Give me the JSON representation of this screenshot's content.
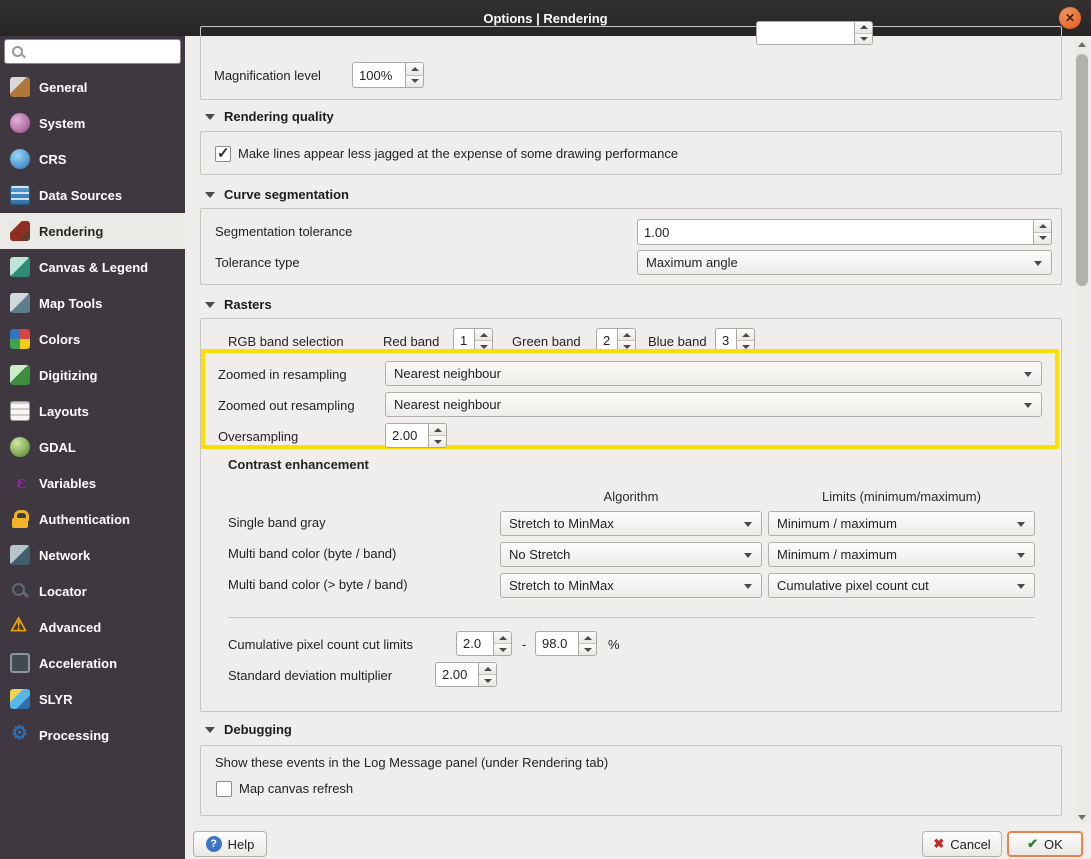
{
  "window": {
    "title": "Options | Rendering"
  },
  "sidebar": {
    "search": {
      "value": "",
      "placeholder": ""
    },
    "items": [
      {
        "label": "General"
      },
      {
        "label": "System"
      },
      {
        "label": "CRS"
      },
      {
        "label": "Data Sources"
      },
      {
        "label": "Rendering",
        "selected": true
      },
      {
        "label": "Canvas & Legend"
      },
      {
        "label": "Map Tools"
      },
      {
        "label": "Colors"
      },
      {
        "label": "Digitizing"
      },
      {
        "label": "Layouts"
      },
      {
        "label": "GDAL"
      },
      {
        "label": "Variables"
      },
      {
        "label": "Authentication"
      },
      {
        "label": "Network"
      },
      {
        "label": "Locator"
      },
      {
        "label": "Advanced"
      },
      {
        "label": "Acceleration"
      },
      {
        "label": "SLYR"
      },
      {
        "label": "Processing"
      }
    ]
  },
  "content": {
    "magnification": {
      "label": "Magnification level",
      "value": "100%"
    },
    "rendering_quality": {
      "title": "Rendering quality",
      "antialias_label": "Make lines appear less jagged at the expense of some drawing performance",
      "antialias_checked": true
    },
    "curve_segmentation": {
      "title": "Curve segmentation",
      "tolerance_label": "Segmentation tolerance",
      "tolerance_value": "1.00",
      "type_label": "Tolerance type",
      "type_value": "Maximum angle"
    },
    "rasters": {
      "title": "Rasters",
      "rgb_label": "RGB band selection",
      "red_label": "Red band",
      "red_value": "1",
      "green_label": "Green band",
      "green_value": "2",
      "blue_label": "Blue band",
      "blue_value": "3",
      "zoomed_in_label": "Zoomed in resampling",
      "zoomed_in_value": "Nearest neighbour",
      "zoomed_out_label": "Zoomed out resampling",
      "zoomed_out_value": "Nearest neighbour",
      "oversampling_label": "Oversampling",
      "oversampling_value": "2.00",
      "highlight_color": "#ffdd00"
    },
    "contrast": {
      "title": "Contrast enhancement",
      "col_algorithm": "Algorithm",
      "col_limits": "Limits (minimum/maximum)",
      "rows": [
        {
          "label": "Single band gray",
          "algorithm": "Stretch to MinMax",
          "limits": "Minimum / maximum"
        },
        {
          "label": "Multi band color (byte / band)",
          "algorithm": "No Stretch",
          "limits": "Minimum / maximum"
        },
        {
          "label": "Multi band color (> byte / band)",
          "algorithm": "Stretch to MinMax",
          "limits": "Cumulative pixel count cut"
        }
      ],
      "cumulative_label": "Cumulative pixel count cut limits",
      "cumulative_min": "2.0",
      "cumulative_dash": "-",
      "cumulative_max": "98.0",
      "cumulative_unit": "%",
      "stddev_label": "Standard deviation multiplier",
      "stddev_value": "2.00"
    },
    "debugging": {
      "title": "Debugging",
      "description": "Show these events in the Log Message panel (under Rendering tab)",
      "map_canvas_refresh_label": "Map canvas refresh",
      "map_canvas_refresh_checked": false
    }
  },
  "footer": {
    "help": "Help",
    "cancel": "Cancel",
    "ok": "OK"
  }
}
